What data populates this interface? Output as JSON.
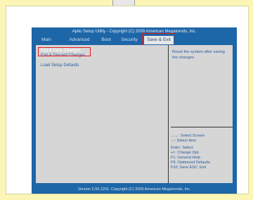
{
  "bios": {
    "title": "Aptio Setup Utility - Copyright (C) 2009 American Megatrends, Inc.",
    "tabs": [
      {
        "label": "Main"
      },
      {
        "label": "Advanced"
      },
      {
        "label": "Boot"
      },
      {
        "label": "Security"
      },
      {
        "label": "Save & Exit"
      }
    ],
    "active_tab": "Save & Exit",
    "menu_items": [
      {
        "label": "Exit & Save Changes"
      },
      {
        "label": "Exit & Discard Changes"
      },
      {
        "label": "Load Setup Defaults"
      }
    ],
    "selected_item": "Exit & Save Changes",
    "help_text": "Reset the system after saving the changes.",
    "key_help": {
      "select_screen": "→←: Select Screen",
      "select_item": "↑↓: Select Item",
      "enter": "Enter: Select",
      "change": "+/-: Change Opt.",
      "f1": "F1: General Help",
      "f9": "F9: Optimized Defaults",
      "f10": "F10: Save  ESC: Exit"
    },
    "footer": "Version 2.00.1201. Copyright (C) 2009 American Megatrends, Inc."
  },
  "colors": {
    "page_background": "#fbf6b6",
    "bios_blue": "#1d66a8",
    "panel_gray": "#d6d6d6",
    "text_blue": "#2a5aa4",
    "highlight_red": "#e11a1a"
  }
}
